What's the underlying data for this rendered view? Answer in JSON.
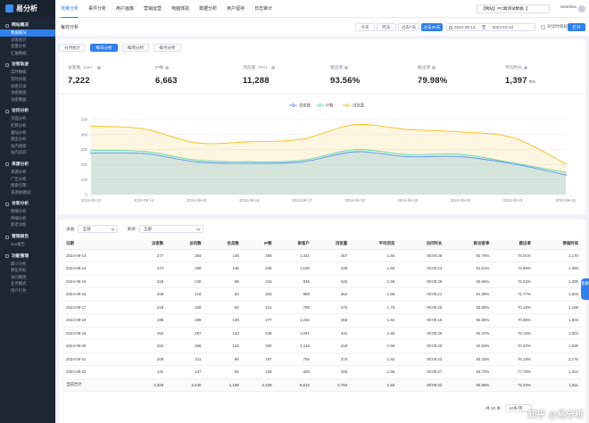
{
  "app": {
    "logo_text": "易分析",
    "accent": "#2f80ed"
  },
  "sidebar": {
    "sections": [
      {
        "title": "网站概况",
        "items": [
          "数据概况",
          "访客统计",
          "流量分析",
          "汇展数据"
        ]
      },
      {
        "title": "访客轨迹",
        "items": [
          "实时数据",
          "实时访客",
          "访客记录",
          "访客搜索",
          "访客数据"
        ]
      },
      {
        "title": "访问分析",
        "items": [
          "页面分析",
          "栏目分析",
          "着陆分析",
          "跳出分析",
          "站内搜索",
          "站内追踪"
        ]
      },
      {
        "title": "来源分析",
        "items": [
          "来源分析",
          "广告分析",
          "搜索引擎",
          "来源关键词"
        ]
      },
      {
        "title": "访客分析",
        "items": [
          "地域分析",
          "终端分析",
          "新老访客"
        ]
      },
      {
        "title": "营销报告",
        "items": [
          "seo报告"
        ]
      },
      {
        "title": "功能管理",
        "items": [
          "漏斗分析",
          "转化目标",
          "访问路径",
          "业务模式",
          "用户行为"
        ]
      }
    ],
    "active_item": "数据概况"
  },
  "topbar": {
    "tabs": [
      "流量分析",
      "事件分析",
      "用户画像",
      "营销运营",
      "电脑体验",
      "数据分析",
      "用户留存",
      "日志审计"
    ],
    "active_tab": 0,
    "site_select": "【网站】PC端测试数据【",
    "user": "wiseDoc"
  },
  "subbar": {
    "breadcrumb": "每日分析",
    "ranges": [
      "今天",
      "昨天",
      "过去7天",
      "过去30天"
    ],
    "active_range": 3,
    "date_start": "2024-09-13",
    "date_sep": "至",
    "date_end": "2024-10-12",
    "compare_label": "对比时间段",
    "more_label": "打开"
  },
  "view_tabs": [
    "分时统计",
    "每日分析",
    "每周分析",
    "每月分析"
  ],
  "active_view_tab": 1,
  "metrics": [
    {
      "label": "访客数（UV）",
      "value": "7,222"
    },
    {
      "label": "IP数",
      "value": "6,663"
    },
    {
      "label": "浏览量（PV）",
      "value": "11,288"
    },
    {
      "label": "跳出率",
      "value": "93.56%"
    },
    {
      "label": "跳出率",
      "value": "79.98%"
    },
    {
      "label": "平均时长",
      "value": "1,397",
      "unit": "ms"
    }
  ],
  "chart_data": {
    "type": "area",
    "x": [
      "2024-09-13",
      "2024-09-14",
      "2024-09-15",
      "2024-09-16",
      "2024-09-17",
      "2024-09-18",
      "2024-09-19",
      "2024-09-20",
      "2024-09-21",
      "2024-09-22"
    ],
    "ylim": [
      0,
      500
    ],
    "yticks": [
      0,
      100,
      200,
      300,
      400,
      500
    ],
    "grid": true,
    "legend_position": "top-center",
    "series": [
      {
        "name": "访客数",
        "color": "#5b8ff9",
        "values": [
          277,
          274,
          218,
          209,
          218,
          285,
          253,
          253,
          205,
          131
        ]
      },
      {
        "name": "IP数",
        "color": "#5ad8a6",
        "values": [
          294,
          288,
          230,
          218,
          228,
          299,
          267,
          268,
          211,
          147
        ]
      },
      {
        "name": "浏览量",
        "color": "#f6bd16",
        "values": [
          457,
          438,
          345,
          352,
          370,
          466,
          434,
          418,
          379,
          205
        ]
      }
    ]
  },
  "table": {
    "filters": [
      {
        "label": "设备:",
        "value": "全部"
      },
      {
        "label": "来源:",
        "value": "全部"
      }
    ],
    "columns": [
      "日期",
      "访客数",
      "访问数",
      "会员数",
      "IP数",
      "新客户",
      "浏览量",
      "平均浏览",
      "访问时长",
      "新访客率",
      "跳出率",
      "停留时间"
    ],
    "rows": [
      [
        "2024-09-13",
        "277",
        "294",
        "148",
        "258",
        "1,331",
        "457",
        "1.65",
        "00:00:28",
        "92.78%",
        "74.01%",
        "1,170"
      ],
      [
        "2024-09-14",
        "274",
        "288",
        "148",
        "248",
        "1,108",
        "438",
        "1.60",
        "00:00:23",
        "91.61%",
        "72.89%",
        "1,483"
      ],
      [
        "2024-09-15",
        "218",
        "230",
        "99",
        "215",
        "839",
        "345",
        "1.58",
        "00:00:28",
        "92.66%",
        "72.02%",
        "1,305"
      ],
      [
        "2024-09-16",
        "209",
        "218",
        "83",
        "203",
        "888",
        "352",
        "1.68",
        "00:00:21",
        "91.39%",
        "71.77%",
        "1,603"
      ],
      [
        "2024-09-17",
        "218",
        "228",
        "83",
        "212",
        "790",
        "370",
        "1.70",
        "00:00:25",
        "93.58%",
        "70.18%",
        "1,168"
      ],
      [
        "2024-09-18",
        "285",
        "299",
        "149",
        "277",
        "1,232",
        "466",
        "1.64",
        "00:00:16",
        "92.98%",
        "70.88%",
        "1,604"
      ],
      [
        "2024-09-19",
        "253",
        "267",
        "143",
        "248",
        "1,091",
        "434",
        "1.60",
        "00:00:20",
        "84.47%",
        "75.19%",
        "1,004"
      ],
      [
        "2024-09-20",
        "253",
        "268",
        "133",
        "250",
        "1,116",
        "418",
        "1.66",
        "00:00:25",
        "92.63%",
        "70.20%",
        "1,639"
      ],
      [
        "2024-09-21",
        "205",
        "211",
        "90",
        "197",
        "756",
        "379",
        "1.63",
        "00:00:23",
        "93.33%",
        "76.19%",
        "2,175"
      ],
      [
        "2024-09-22",
        "131",
        "147",
        "83",
        "128",
        "626",
        "205",
        "1.55",
        "00:00:27",
        "93.73%",
        "77.78%",
        "1,404"
      ]
    ],
    "total": [
      "当前合计",
      "2,325",
      "2,440",
      "1,159",
      "2,229",
      "9,612",
      "3,794",
      "1.63",
      "00:00:22",
      "92.86%",
      "72.34%",
      "1,511"
    ]
  },
  "pager": {
    "total_text": "共 30 条",
    "page_size": "10条/页"
  },
  "float_button": "客服",
  "watermark": "知乎 @易分析"
}
